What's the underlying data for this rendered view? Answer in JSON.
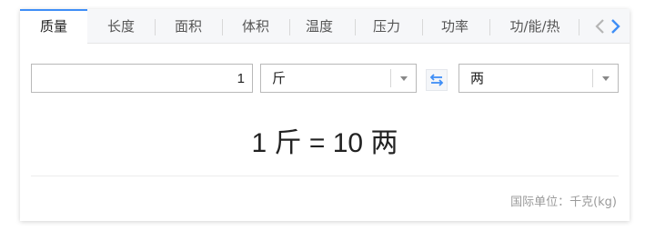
{
  "tabs": [
    {
      "label": "质量",
      "active": true
    },
    {
      "label": "长度"
    },
    {
      "label": "面积"
    },
    {
      "label": "体积"
    },
    {
      "label": "温度"
    },
    {
      "label": "压力"
    },
    {
      "label": "功率"
    },
    {
      "label": "功/能/热"
    }
  ],
  "converter": {
    "input_value": "1",
    "from_unit": "斤",
    "to_unit": "两",
    "result": "1 斤 = 10 两"
  },
  "footer": {
    "note": "国际单位：千克(kg)"
  },
  "colors": {
    "accent": "#3f8ef6",
    "tab_bar_bg": "#f6f7f9",
    "muted_text": "#9a9a9a"
  },
  "icons": {
    "prev": "chevron-left-icon",
    "next": "chevron-right-icon",
    "swap": "swap-arrows-icon",
    "dropdown": "caret-down-icon"
  }
}
